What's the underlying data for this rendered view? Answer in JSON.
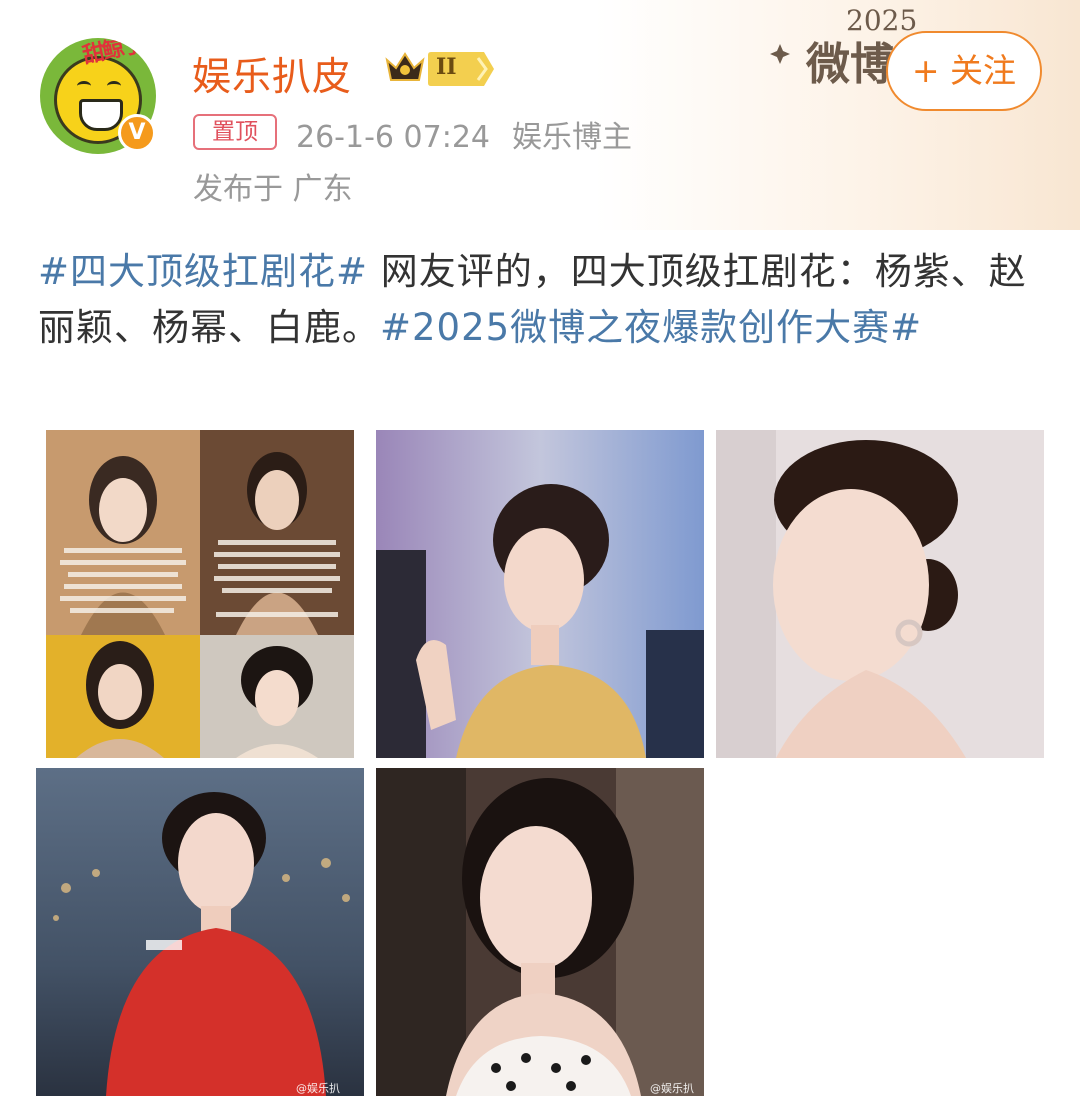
{
  "post": {
    "author": {
      "name": "娱乐扒皮",
      "avatar_caption": "甜鲸了",
      "verified_label": "V",
      "level": "II",
      "badge_icon": "crown-icon"
    },
    "header_logo": {
      "year": "2025",
      "title": "微博"
    },
    "follow_button": "+ 关注",
    "pinned_label": "置顶",
    "time": "26-1-6 07:24",
    "author_role": "娱乐博主",
    "location": "发布于 广东",
    "content": {
      "tag1": "#四大顶级扛剧花#",
      "body": " 网友评的，四大顶级扛剧花：杨紫、赵丽颖、杨幂、白鹿。",
      "tag2": "#2025微博之夜爆款创作大赛#"
    },
    "images": [
      {
        "name": "collage-four-actresses"
      },
      {
        "name": "actress-yellow-dress"
      },
      {
        "name": "actress-side-portrait"
      },
      {
        "name": "actress-red-dress",
        "watermark": "@娱乐扒"
      },
      {
        "name": "actress-winking",
        "watermark": "@娱乐扒皮"
      }
    ]
  },
  "colors": {
    "author": "#e85c1b",
    "follow": "#f07a1d",
    "hashtag": "#4a79a8",
    "pin": "#e0505c",
    "meta": "#999999"
  }
}
